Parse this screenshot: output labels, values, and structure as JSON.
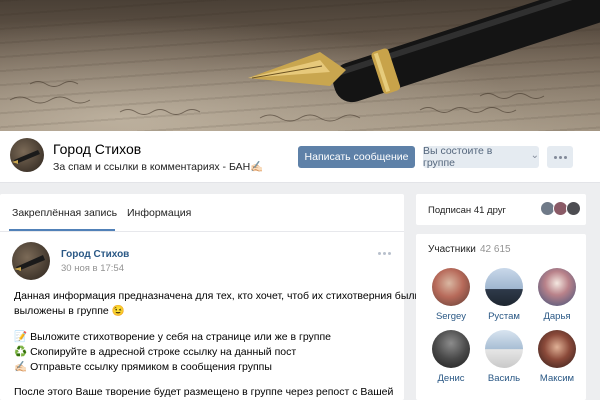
{
  "group": {
    "name": "Город Стихов",
    "status": "За спам и ссылки в комментариях - БАН✍🏻"
  },
  "actions": {
    "message_label": "Написать сообщение",
    "membership_label": "Вы состоите в группе",
    "membership_chevron": "⌄"
  },
  "tabs": [
    {
      "label": "Закреплённая запись",
      "active": true
    },
    {
      "label": "Информация",
      "active": false
    }
  ],
  "post": {
    "author": "Город Стихов",
    "date": "30 ноя в 17:54",
    "lines": [
      {
        "emoji": "",
        "text": "Данная информация предназначена для тех, кто хочет, чтоб их стихотверния были"
      },
      {
        "emoji": "",
        "text": "выложены в группе 😉"
      },
      {
        "emoji": "📝",
        "text": "Выложите стихотворение у себя на странице или же в группе"
      },
      {
        "emoji": "♻️",
        "text": "Скопируйте в адресной строке ссылку на данный пост"
      },
      {
        "emoji": "✍🏻",
        "text": "Отправьте ссылку прямиком в сообщения группы"
      },
      {
        "emoji": "",
        "text": "После этого Ваше творение будет размещено в группе через репост с Вашей"
      }
    ]
  },
  "friends": {
    "label": "Подписан 41 друг"
  },
  "members": {
    "title": "Участники",
    "count": "42 615",
    "people": [
      {
        "name": "Sergey"
      },
      {
        "name": "Рустам"
      },
      {
        "name": "Дарья"
      },
      {
        "name": "Денис"
      },
      {
        "name": "Василь"
      },
      {
        "name": "Максим"
      }
    ]
  },
  "icons": {
    "more": "more-icon",
    "chevron": "chevron-down-icon"
  },
  "colors": {
    "accent": "#5e81a8",
    "link": "#2a5885",
    "background": "#edeef0"
  }
}
